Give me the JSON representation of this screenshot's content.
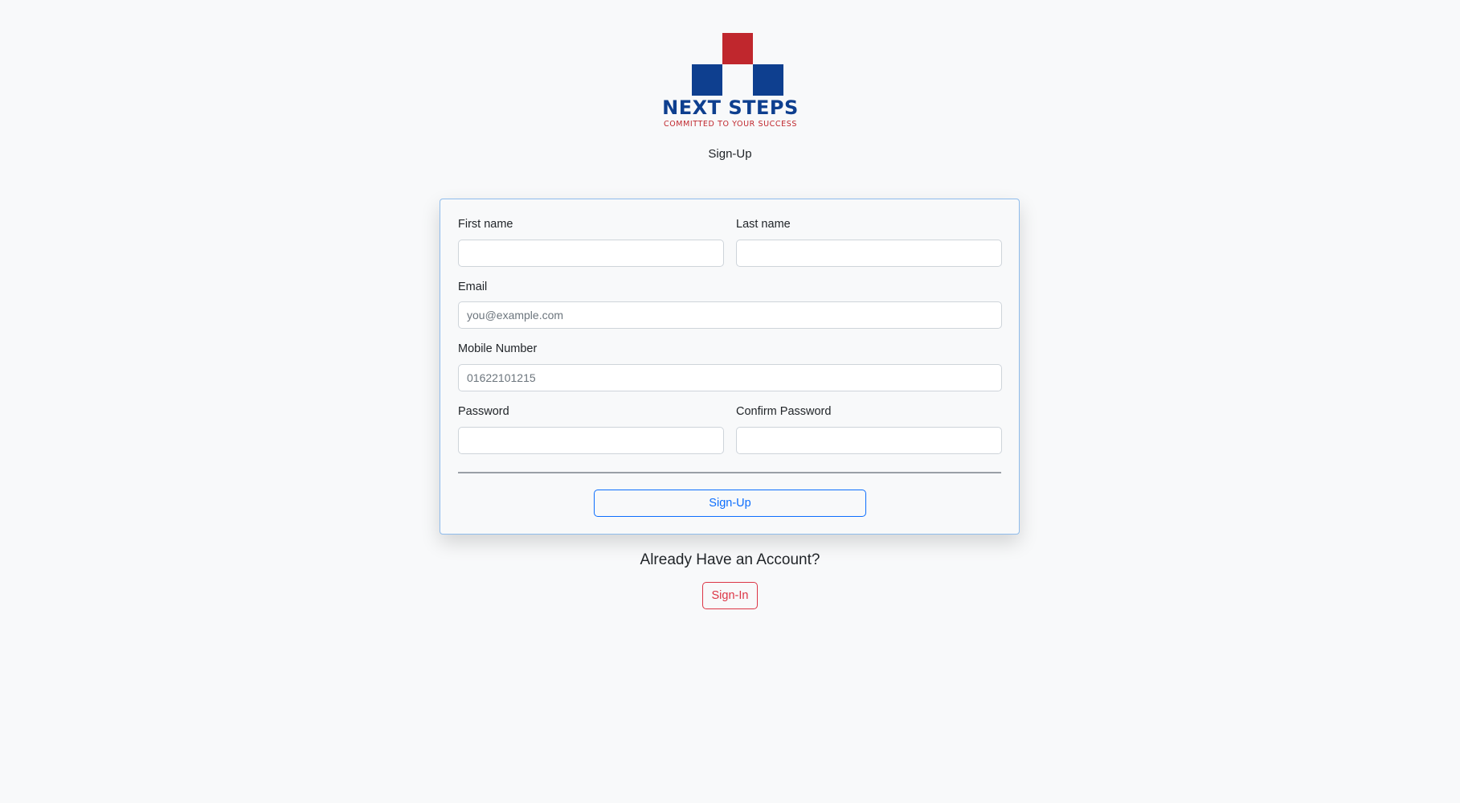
{
  "brand": {
    "name": "NEXT STEPS",
    "tagline": "COMMITTED TO YOUR SUCCESS",
    "colors": {
      "red": "#c0272d",
      "blue": "#0e3f8f"
    }
  },
  "page": {
    "subtitle": "Sign-Up"
  },
  "form": {
    "first_name": {
      "label": "First name",
      "value": "",
      "placeholder": ""
    },
    "last_name": {
      "label": "Last name",
      "value": "",
      "placeholder": ""
    },
    "email": {
      "label": "Email",
      "value": "",
      "placeholder": "you@example.com"
    },
    "mobile": {
      "label": "Mobile Number",
      "value": "",
      "placeholder": "01622101215"
    },
    "password": {
      "label": "Password",
      "value": "",
      "placeholder": ""
    },
    "confirm_password": {
      "label": "Confirm Password",
      "value": "",
      "placeholder": ""
    },
    "submit_label": "Sign-Up"
  },
  "signin": {
    "prompt": "Already Have an Account?",
    "button_label": "Sign-In"
  },
  "colors": {
    "primary": "#0d6efd",
    "danger": "#dc3545",
    "background": "#f8f9fa",
    "card_border": "#8fbcec"
  }
}
